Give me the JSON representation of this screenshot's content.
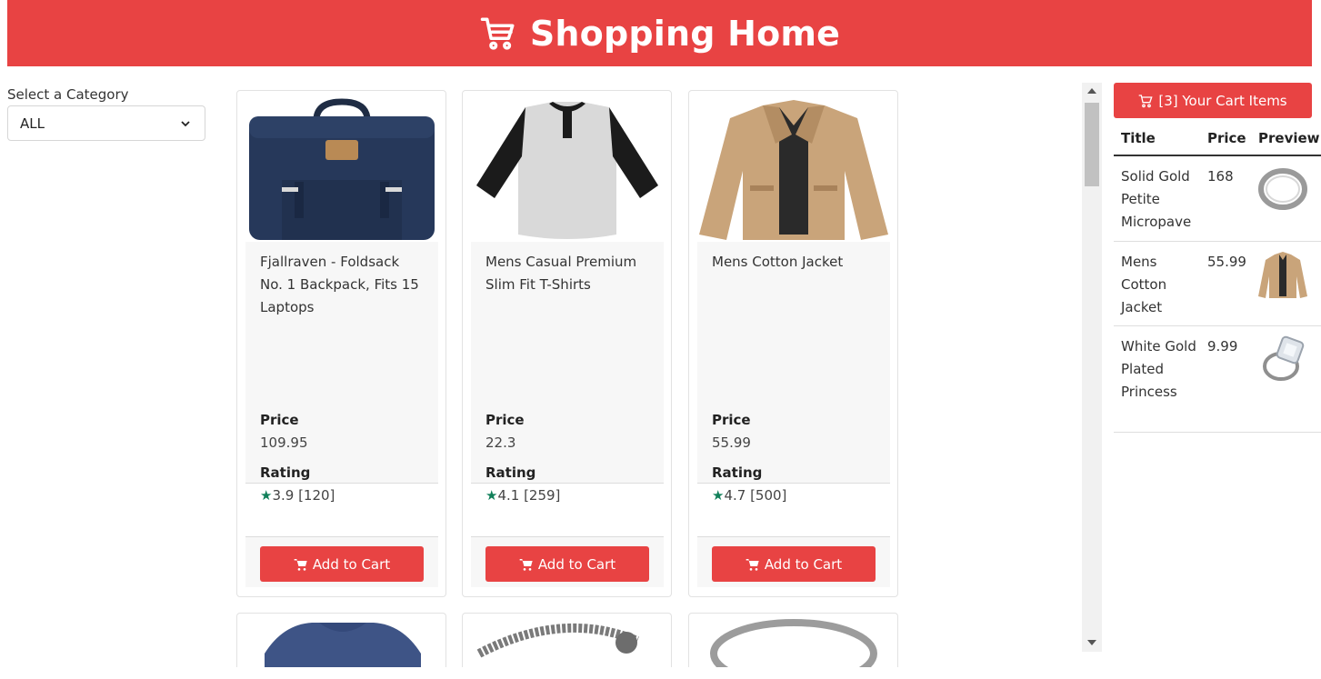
{
  "header": {
    "title": "Shopping Home",
    "icon": "cart-icon"
  },
  "filter": {
    "label": "Select a Category",
    "selected": "ALL"
  },
  "products": [
    {
      "title": "Fjallraven - Foldsack No. 1 Backpack, Fits 15 Laptops",
      "price_label": "Price",
      "price": "109.95",
      "rating_label": "Rating",
      "rating": "3.9 [120]",
      "button": "Add to Cart",
      "image": "backpack"
    },
    {
      "title": "Mens Casual Premium Slim Fit T-Shirts",
      "price_label": "Price",
      "price": "22.3",
      "rating_label": "Rating",
      "rating": "4.1 [259]",
      "button": "Add to Cart",
      "image": "tshirt"
    },
    {
      "title": "Mens Cotton Jacket",
      "price_label": "Price",
      "price": "55.99",
      "rating_label": "Rating",
      "rating": "4.7 [500]",
      "button": "Add to Cart",
      "image": "jacket"
    }
  ],
  "cart": {
    "button_label": "[3] Your Cart Items",
    "columns": [
      "Title",
      "Price",
      "Preview"
    ],
    "items": [
      {
        "title": "Solid Gold Petite Micropave",
        "price": "168",
        "image": "ring"
      },
      {
        "title": "Mens Cotton Jacket",
        "price": "55.99",
        "image": "jacket"
      },
      {
        "title": "White Gold Plated Princess",
        "price": "9.99",
        "image": "diamond-ring"
      }
    ]
  },
  "colors": {
    "accent": "#e84343",
    "star": "#11805a"
  }
}
